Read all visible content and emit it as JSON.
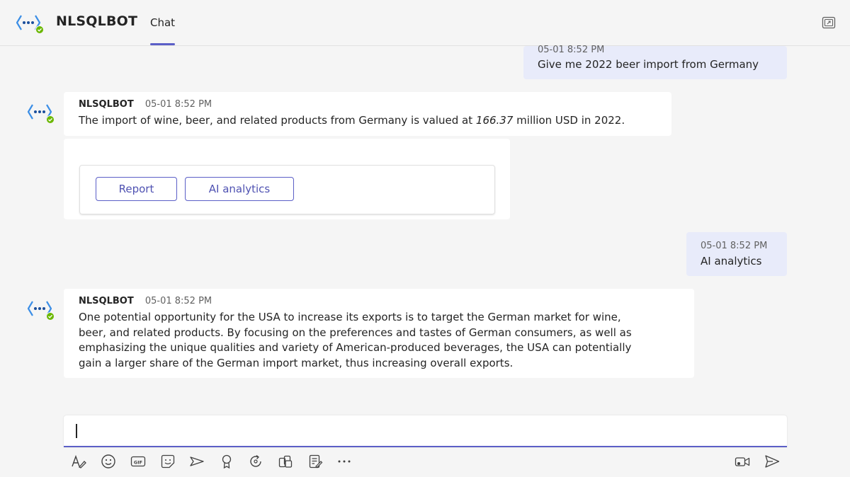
{
  "header": {
    "app_name": "NLSQLBOT",
    "tab_label": "Chat"
  },
  "messages": [
    {
      "role": "user",
      "timestamp": "05-01 8:52 PM",
      "text": "Give me 2022 beer import from Germany"
    },
    {
      "role": "bot",
      "sender": "NLSQLBOT",
      "timestamp": "05-01 8:52 PM",
      "text_before": "The import of wine, beer, and related products from Germany is valued at ",
      "text_value": "166.37",
      "text_after": " million USD in 2022."
    },
    {
      "role": "user",
      "timestamp": "05-01 8:52 PM",
      "text": "AI analytics"
    },
    {
      "role": "bot",
      "sender": "NLSQLBOT",
      "timestamp": "05-01 8:52 PM",
      "lines": [
        "One potential opportunity for the USA to increase its exports is to target the German market for wine,",
        "beer, and related products. By focusing on the preferences and tastes of German consumers, as well as",
        "emphasizing the unique qualities and variety of American-produced beverages, the USA can potentially",
        "gain a larger share of the German import market, thus increasing overall exports."
      ]
    }
  ],
  "actions": {
    "report_label": "Report",
    "ai_analytics_label": "AI analytics"
  },
  "compose": {
    "placeholder": "",
    "value": ""
  },
  "toolbar": {
    "icons": [
      "format-icon",
      "emoji-icon",
      "gif-icon",
      "sticker-icon",
      "schedule-meeting-icon",
      "praise-icon",
      "loop-icon",
      "apps-icon",
      "approvals-icon",
      "more-options-icon"
    ],
    "right_icons": [
      "video-clip-icon",
      "send-icon"
    ]
  },
  "colors": {
    "accent": "#5b5fc7",
    "user_bubble": "#e8ebfa",
    "background": "#f5f5f5"
  }
}
